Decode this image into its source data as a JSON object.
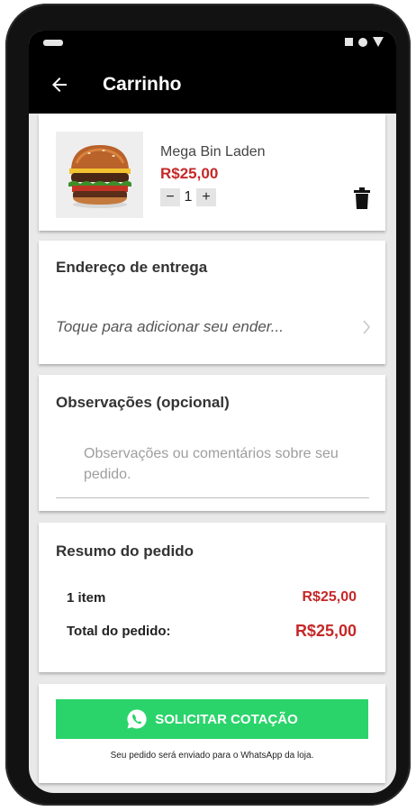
{
  "app": {
    "title": "Carrinho"
  },
  "cart": {
    "item": {
      "name": "Mega Bin Laden",
      "price": "R$25,00",
      "quantity": "1",
      "decrement": "−",
      "increment": "+"
    }
  },
  "address": {
    "title": "Endereço de entrega",
    "placeholder": "Toque para adicionar seu ender..."
  },
  "notes": {
    "title": "Observações (opcional)",
    "placeholder": "Observações ou comentários sobre seu pedido."
  },
  "summary": {
    "title": "Resumo do pedido",
    "items_label": "1 item",
    "items_value": "R$25,00",
    "total_label": "Total do pedido:",
    "total_value": "R$25,00"
  },
  "checkout": {
    "button_label": "SOLICITAR COTAÇÃO",
    "note": "Seu pedido será enviado para o WhatsApp da loja."
  },
  "colors": {
    "price": "#c62828",
    "whatsapp_button": "#2ad46a",
    "appbar": "#000000"
  }
}
